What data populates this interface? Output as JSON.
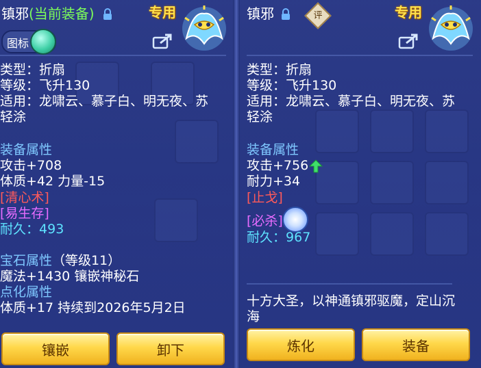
{
  "left": {
    "name": "镇邪",
    "status": "(当前装备)",
    "tag": "专用",
    "toggle_label": "图标",
    "type_line": "类型：折扇",
    "level_line": "等级：飞升130",
    "suitable_line1": "适用：龙啸云、慕子白、明无夜、苏",
    "suitable_line2": "轻涂",
    "attr_title": "装备属性",
    "attack": "攻击+708",
    "physique": "体质+42 力量-15",
    "skill1": "[清心术]",
    "skill2": "[易生存]",
    "durability_label": "耐久：",
    "durability_value": "493",
    "gem_title": "宝石属性",
    "gem_level": "（等级11）",
    "gem_line": "魔法+1430 镶嵌神秘石",
    "refine_title": "点化属性",
    "refine_line": "体质+17 持续到2026年5月2日",
    "btn_inlay": "镶嵌",
    "btn_remove": "卸下"
  },
  "right": {
    "name": "镇邪",
    "badge": "评",
    "tag": "专用",
    "type_line": "类型：折扇",
    "level_line": "等级：飞升130",
    "suitable_line1": "适用：龙啸云、慕子白、明无夜、苏",
    "suitable_line2": "轻涂",
    "attr_title": "装备属性",
    "attack": "攻击+756",
    "endurance": "耐力+34",
    "skill1": "[止戈]",
    "skill2": "[必杀]",
    "durability_label": "耐久：",
    "durability_value": "967",
    "desc_line1": "十方大圣，以神通镇邪驱魔，定山沉",
    "desc_line2": "海",
    "btn_refine": "炼化",
    "btn_equip": "装备"
  },
  "icons": {
    "lock": "lock-icon",
    "share": "share-icon",
    "emblem": "exclusive-emblem-icon",
    "up_arrow": "up-arrow-icon",
    "swirl": "special-skill-swirl-icon"
  },
  "colors": {
    "gold_text": "#ffe14d",
    "green_status": "#7CFC5A",
    "attr_title": "#7fc8ff",
    "durability": "#5ee3ff",
    "skill_red": "#ff5a5a",
    "skill_magenta": "#e86cff",
    "button_gold": "#ffd84a"
  }
}
